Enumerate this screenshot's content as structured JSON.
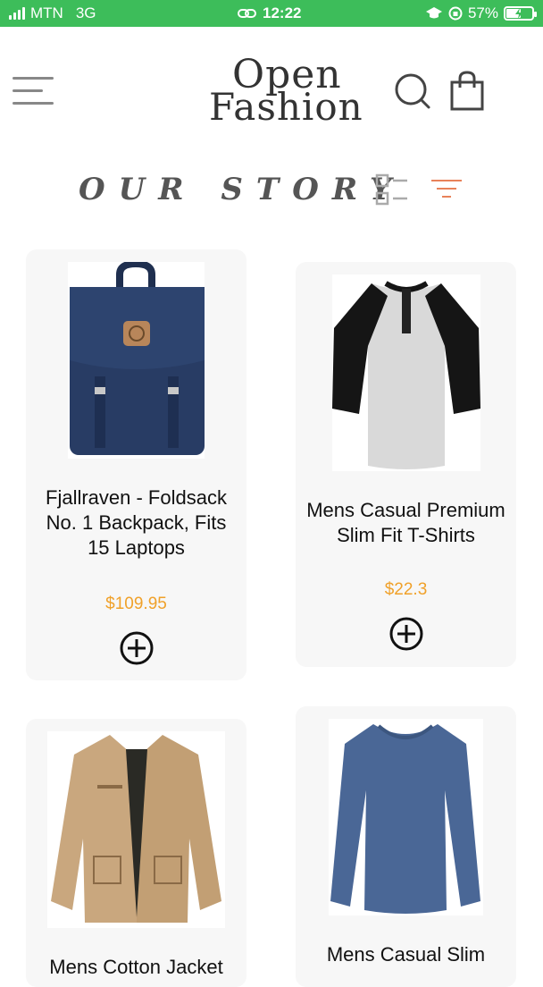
{
  "status": {
    "carrier": "MTN",
    "network": "3G",
    "time": "12:22",
    "battery": "57%",
    "battery_level": 0.57
  },
  "header": {
    "logo_line1": "Open",
    "logo_line2": "Fashion",
    "menu_icon": "hamburger-icon",
    "search_icon": "search-icon",
    "cart_icon": "shopping-bag-icon"
  },
  "section": {
    "title": "OUR STORY",
    "list_icon": "list-view-icon",
    "filter_icon": "filter-icon"
  },
  "colors": {
    "status_bar": "#3dbd5a",
    "price": "#f0a12a",
    "filter_accent": "#e8825a",
    "card_bg": "#f7f7f7"
  },
  "products": [
    {
      "title": "Fjallraven - Foldsack No. 1 Backpack, Fits 15 Laptops",
      "price": "$109.95",
      "image": "navy-backpack"
    },
    {
      "title": "Mens Casual Premium Slim Fit T-Shirts",
      "price": "$22.3",
      "image": "raglan-henley-shirt"
    },
    {
      "title": "Mens Cotton Jacket",
      "price": "",
      "image": "tan-cotton-jacket"
    },
    {
      "title": "Mens Casual Slim",
      "price": "",
      "image": "blue-long-sleeve-shirt"
    }
  ]
}
